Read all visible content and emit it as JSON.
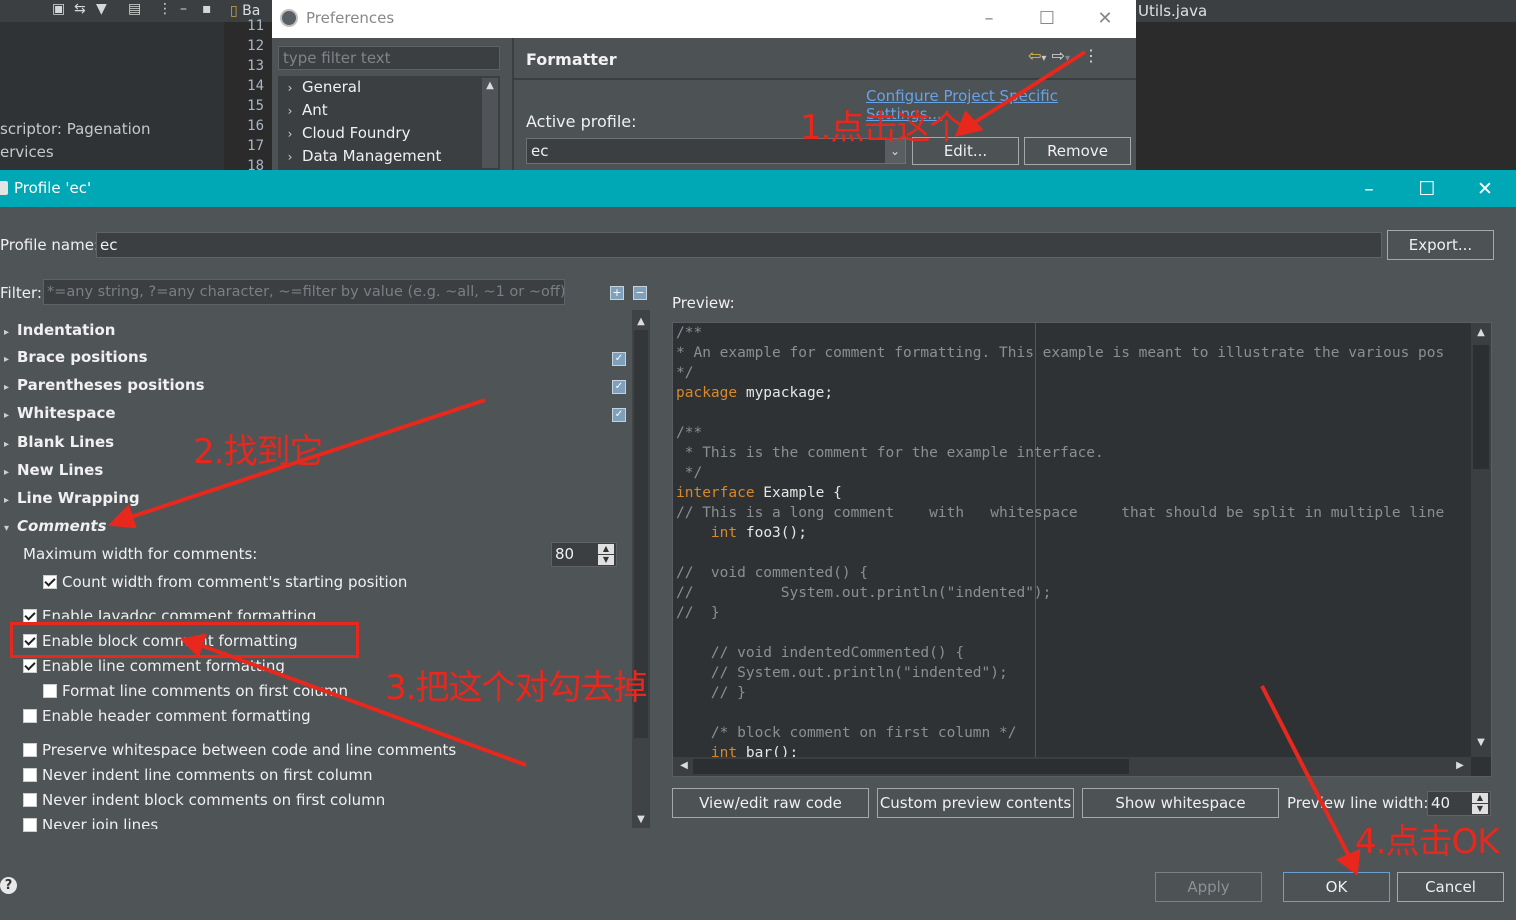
{
  "background": {
    "editor_tab_label": "Ba",
    "right_tab_label": "Utils.java",
    "left_texts": [
      "scriptor: Pagenation",
      "ervices"
    ],
    "line_numbers": [
      "11",
      "12",
      "13",
      "14",
      "15",
      "16",
      "17",
      "18"
    ]
  },
  "preferences": {
    "title": "Preferences",
    "filter_placeholder": "type filter text",
    "tree_items": [
      "General",
      "Ant",
      "Cloud Foundry",
      "Data Management"
    ],
    "heading": "Formatter",
    "config_link": "Configure Project Specific Settings...",
    "active_profile_label": "Active profile:",
    "active_profile_value": "ec",
    "edit_button": "Edit...",
    "remove_button": "Remove"
  },
  "profile": {
    "title": "Profile 'ec'",
    "name_label": "Profile name:",
    "name_value": "ec",
    "export_button": "Export...",
    "filter_label": "Filter:",
    "filter_placeholder": "*=any string, ?=any character, ~=filter by value (e.g. ~all, ~1 or ~off)",
    "tree": [
      {
        "label": "Indentation",
        "expanded": false,
        "edited": false
      },
      {
        "label": "Brace positions",
        "expanded": false,
        "edited": true
      },
      {
        "label": "Parentheses positions",
        "expanded": false,
        "edited": true
      },
      {
        "label": "Whitespace",
        "expanded": false,
        "edited": true
      },
      {
        "label": "Blank Lines",
        "expanded": false,
        "edited": false
      },
      {
        "label": "New Lines",
        "expanded": false,
        "edited": false
      },
      {
        "label": "Line Wrapping",
        "expanded": false,
        "edited": false
      },
      {
        "label": "Comments",
        "expanded": true,
        "edited": false
      }
    ],
    "max_width_label": "Maximum width for comments:",
    "max_width_value": "80",
    "options": [
      {
        "label": "Count width from comment's starting position",
        "checked": true
      },
      {
        "label": "Enable Javadoc comment formatting",
        "checked": true
      },
      {
        "label": "Enable block comment formatting",
        "checked": true
      },
      {
        "label": "Enable line comment formatting",
        "checked": true
      },
      {
        "label": "Format line comments on first column",
        "checked": false
      },
      {
        "label": "Enable header comment formatting",
        "checked": false
      },
      {
        "label": "Preserve whitespace between code and line comments",
        "checked": false
      },
      {
        "label": "Never indent line comments on first column",
        "checked": false
      },
      {
        "label": "Never indent block comments on first column",
        "checked": false
      },
      {
        "label": "Never join lines",
        "checked": false
      }
    ],
    "preview_label": "Preview:",
    "preview_lines": [
      "/**",
      "* An example for comment formatting. This example is meant to illustrate the various pos",
      "*/",
      "package mypackage;",
      "",
      "/**",
      " * This is the comment for the example interface.",
      " */",
      "interface Example {",
      "// This is a long comment    with   whitespace     that should be split in multiple line",
      "    int foo3();",
      "",
      "//  void commented() {",
      "//          System.out.println(\"indented\");",
      "//  }",
      "",
      "    // void indentedCommented() {",
      "    // System.out.println(\"indented\");",
      "    // }",
      "",
      "    /* block comment on first column */",
      "    int bar();"
    ],
    "view_raw_button": "View/edit raw code",
    "custom_preview_button": "Custom preview contents",
    "show_whitespace_button": "Show whitespace",
    "preview_width_label": "Preview line width:",
    "preview_width_value": "40",
    "apply_button": "Apply",
    "ok_button": "OK",
    "cancel_button": "Cancel",
    "help_icon": "?"
  },
  "annotations": {
    "step1": "1.点击这个",
    "step2": "2.找到它",
    "step3": "3.把这个对勾去掉",
    "step4": "4.点击OK",
    "color": "#e8271d"
  }
}
